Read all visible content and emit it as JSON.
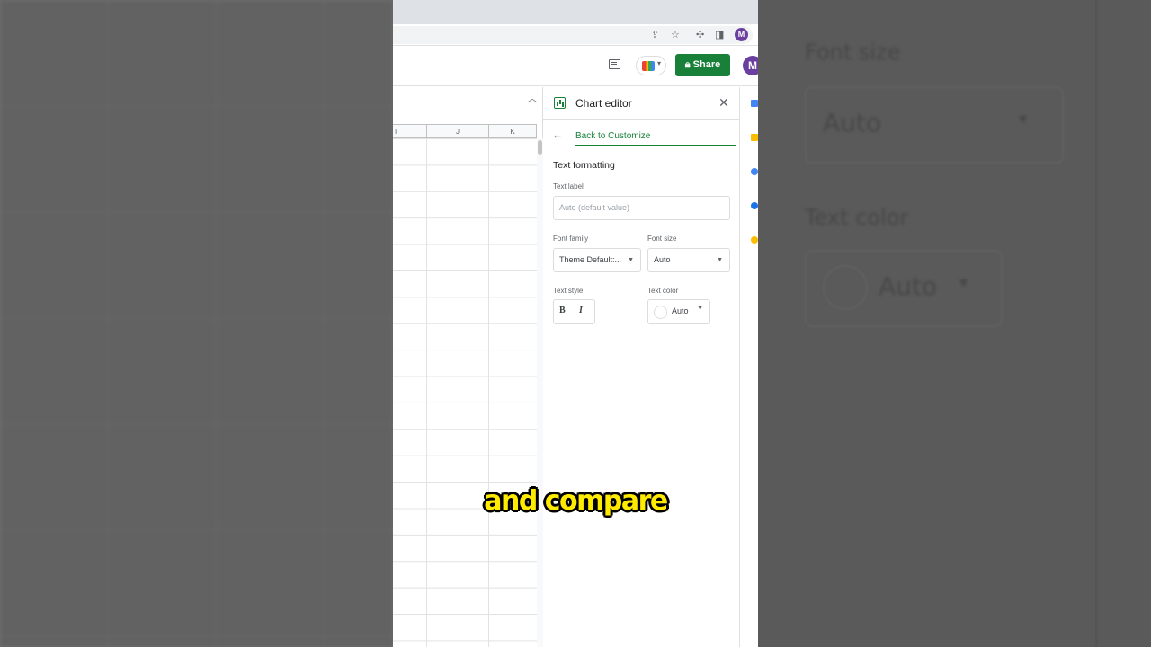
{
  "background_right": {
    "font_size_label": "Font size",
    "font_size_value": "Auto",
    "text_color_label": "Text color",
    "text_color_value": "Auto"
  },
  "app": {
    "avatar_letter": "M",
    "share_label": "Share"
  },
  "sheet": {
    "columns": [
      "I",
      "J",
      "K"
    ]
  },
  "chart_editor": {
    "title": "Chart editor",
    "back_label": "Back to Customize",
    "section_title": "Text formatting",
    "text_label": {
      "label": "Text label",
      "placeholder": "Auto (default value)"
    },
    "font_family": {
      "label": "Font family",
      "value": "Theme Default:..."
    },
    "font_size": {
      "label": "Font size",
      "value": "Auto"
    },
    "text_style": {
      "label": "Text style",
      "bold": "B",
      "italic": "I"
    },
    "text_color": {
      "label": "Text color",
      "value": "Auto"
    }
  },
  "caption": "and compare",
  "colors": {
    "accent_green": "#188038",
    "avatar_purple": "#6a3fa0",
    "caption_yellow": "#ffeb00"
  }
}
